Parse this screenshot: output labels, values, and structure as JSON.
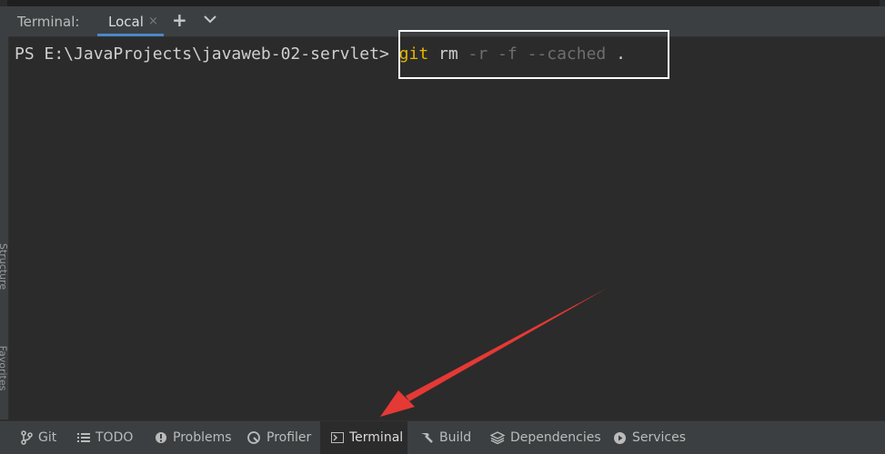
{
  "tool_window": {
    "title": "Terminal:"
  },
  "tabs": [
    {
      "label": "Local",
      "close": "×"
    }
  ],
  "tab_actions": {
    "add": "+",
    "dropdown_icon": "chevron-down-icon"
  },
  "terminal": {
    "prompt": "PS E:\\JavaProjects\\javaweb-02-servlet>",
    "command": "git",
    "args": "rm",
    "options": "-r -f --cached",
    "path": "."
  },
  "left_rail": {
    "labels": [
      "Structure",
      "Favorites"
    ]
  },
  "bottom_tools": [
    {
      "label": "Git",
      "icon": "branch-icon"
    },
    {
      "label": "TODO",
      "icon": "list-icon"
    },
    {
      "label": "Problems",
      "icon": "info-icon"
    },
    {
      "label": "Profiler",
      "icon": "profiler-icon"
    },
    {
      "label": "Terminal",
      "icon": "terminal-icon",
      "active": true
    },
    {
      "label": "Build",
      "icon": "hammer-icon"
    },
    {
      "label": "Dependencies",
      "icon": "layers-icon"
    },
    {
      "label": "Services",
      "icon": "play-circle-icon"
    }
  ],
  "colors": {
    "accent": "#4a88c7",
    "annotation": "#e53935",
    "highlight_box": "#ffffff"
  }
}
